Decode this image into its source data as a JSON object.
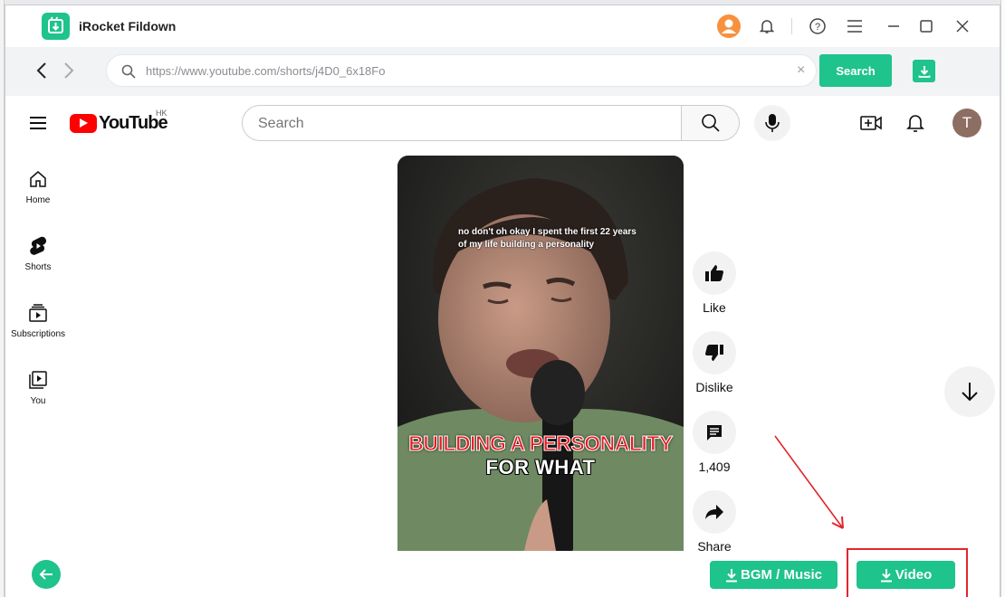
{
  "app": {
    "title": "iRocket Fildown",
    "accent_color": "#1fc38c",
    "titlebar_icons": [
      "avatar-icon",
      "bell-icon",
      "help-icon",
      "menu-icon",
      "minimize-icon",
      "maximize-icon",
      "close-icon"
    ]
  },
  "addressbar": {
    "url": "https://www.youtube.com/shorts/j4D0_6x18Fo",
    "clear_glyph": "×",
    "search_label": "Search"
  },
  "youtube": {
    "logo_text": "YouTube",
    "region": "HK",
    "search_placeholder": "Search",
    "avatar_letter": "T",
    "guide": [
      {
        "label": "Home",
        "icon": "home-icon"
      },
      {
        "label": "Shorts",
        "icon": "shorts-icon"
      },
      {
        "label": "Subscriptions",
        "icon": "subscriptions-icon"
      },
      {
        "label": "You",
        "icon": "you-icon"
      }
    ],
    "video": {
      "caption_top": "no don't oh okay I spent the first 22 years of my life building a personality",
      "caption_red": "BUILDING A PERSONALITY",
      "caption_white": "FOR WHAT"
    },
    "actions": [
      {
        "label": "Like",
        "icon": "thumbs-up-icon"
      },
      {
        "label": "Dislike",
        "icon": "thumbs-down-icon"
      },
      {
        "label": "1,409",
        "icon": "comment-icon"
      },
      {
        "label": "Share",
        "icon": "share-icon"
      }
    ]
  },
  "footer": {
    "bgm_label": "BGM / Music",
    "video_label": "Video",
    "highlight_color": "#e2262b"
  }
}
